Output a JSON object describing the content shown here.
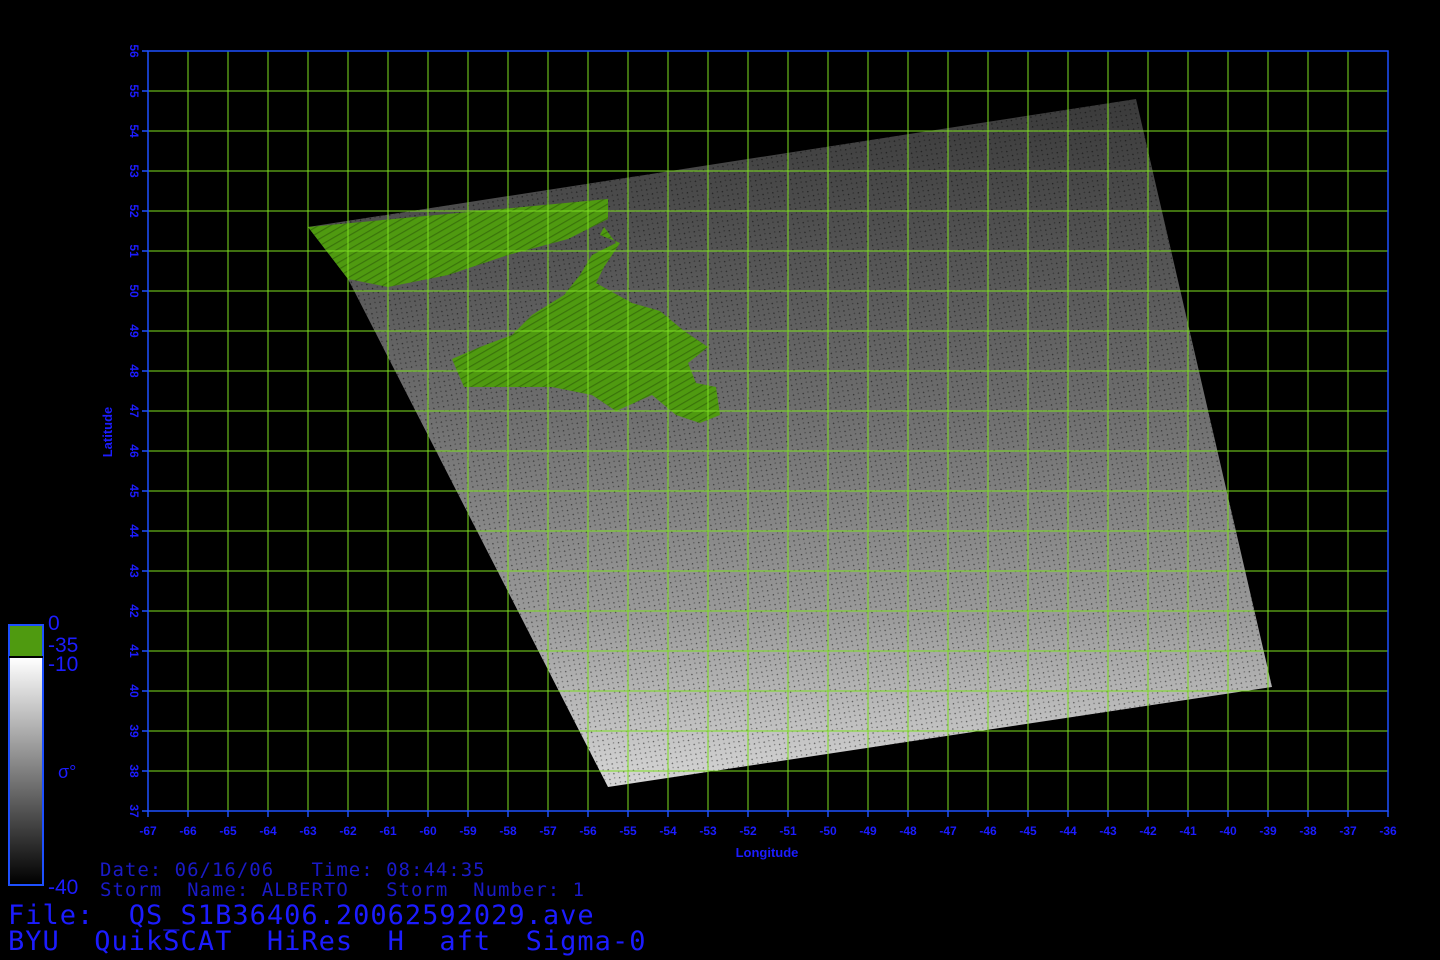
{
  "meta": {
    "date_line": "Date: 06/16/06   Time: 08:44:35",
    "storm_line": "Storm  Name: ALBERTO   Storm  Number: 1",
    "file_line": "File:  QS_S1B36406.20062592029.ave",
    "product_line": "BYU  QuikSCAT  HiRes  H  aft  Sigma-0"
  },
  "axes": {
    "x_label": "Longitude",
    "y_label": "Latitude",
    "lon_min": -67,
    "lon_max": -36,
    "lat_min": 37,
    "lat_max": 56,
    "lon_ticks": [
      "-67",
      "-66",
      "-65",
      "-64",
      "-63",
      "-62",
      "-61",
      "-60",
      "-59",
      "-58",
      "-57",
      "-56",
      "-55",
      "-54",
      "-53",
      "-52",
      "-51",
      "-50",
      "-49",
      "-48",
      "-47",
      "-46",
      "-45",
      "-44",
      "-43",
      "-42",
      "-41",
      "-40",
      "-39",
      "-38",
      "-37",
      "-36"
    ],
    "lat_ticks": [
      "37",
      "38",
      "39",
      "40",
      "41",
      "42",
      "43",
      "44",
      "45",
      "46",
      "47",
      "48",
      "49",
      "50",
      "51",
      "52",
      "53",
      "54",
      "55",
      "56"
    ]
  },
  "colorbar": {
    "land_top": "0",
    "land_bottom": "-35",
    "sea_top": "-10",
    "sea_bottom": "-40",
    "symbol": "σ°"
  },
  "colors": {
    "frame": "#1e50ff",
    "grid": "#7ee020",
    "land": "#4f9a10",
    "tick_text": "#1c1cff"
  },
  "swath": {
    "corners_lonlat": [
      [
        -63.0,
        51.6
      ],
      [
        -42.3,
        54.8
      ],
      [
        -38.9,
        40.1
      ],
      [
        -55.5,
        37.6
      ],
      [
        -62.0,
        50.3
      ]
    ]
  },
  "land_regions": {
    "labrador": [
      [
        -63.0,
        51.6
      ],
      [
        -55.5,
        52.3
      ],
      [
        -55.5,
        51.8
      ],
      [
        -56.5,
        51.3
      ],
      [
        -58.0,
        50.9
      ],
      [
        -59.5,
        50.4
      ],
      [
        -61.0,
        50.1
      ],
      [
        -62.0,
        50.3
      ]
    ],
    "newfoundland": [
      [
        -55.6,
        51.6
      ],
      [
        -55.3,
        51.2
      ],
      [
        -55.9,
        50.9
      ],
      [
        -56.2,
        50.4
      ],
      [
        -56.6,
        49.9
      ],
      [
        -57.4,
        49.4
      ],
      [
        -57.9,
        48.9
      ],
      [
        -58.7,
        48.6
      ],
      [
        -59.4,
        48.3
      ],
      [
        -59.1,
        47.6
      ],
      [
        -58.1,
        47.6
      ],
      [
        -56.9,
        47.6
      ],
      [
        -55.9,
        47.4
      ],
      [
        -55.3,
        47.0
      ],
      [
        -54.4,
        47.4
      ],
      [
        -53.8,
        46.9
      ],
      [
        -53.2,
        46.7
      ],
      [
        -52.7,
        46.9
      ],
      [
        -52.8,
        47.6
      ],
      [
        -53.3,
        47.7
      ],
      [
        -53.5,
        48.2
      ],
      [
        -53.0,
        48.6
      ],
      [
        -53.6,
        49.0
      ],
      [
        -54.2,
        49.5
      ],
      [
        -54.9,
        49.7
      ],
      [
        -55.8,
        50.2
      ],
      [
        -55.6,
        50.6
      ],
      [
        -55.2,
        51.2
      ],
      [
        -55.7,
        51.4
      ]
    ]
  }
}
